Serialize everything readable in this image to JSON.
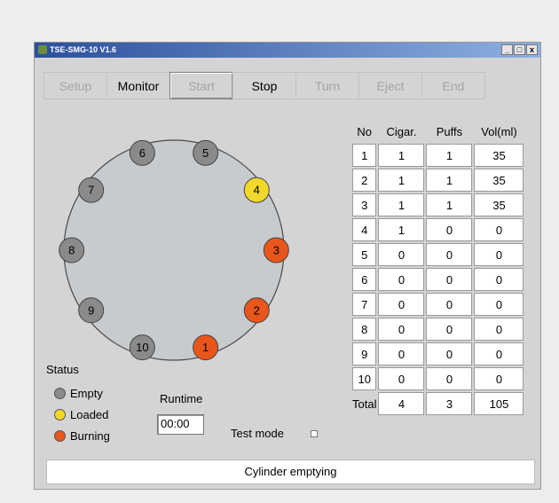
{
  "window": {
    "title": "TSE-SMG-10 V1.6",
    "controls": [
      "_",
      "□",
      "x"
    ]
  },
  "toolbar": [
    {
      "label": "Setup",
      "enabled": false,
      "pressed": false
    },
    {
      "label": "Monitor",
      "enabled": true,
      "pressed": false
    },
    {
      "label": "Start",
      "enabled": false,
      "pressed": true
    },
    {
      "label": "Stop",
      "enabled": true,
      "pressed": false
    },
    {
      "label": "Turn",
      "enabled": false,
      "pressed": false
    },
    {
      "label": "Eject",
      "enabled": false,
      "pressed": false
    },
    {
      "label": "End",
      "enabled": false,
      "pressed": false
    }
  ],
  "wheel": {
    "ports": [
      {
        "number": "1",
        "state": "burning"
      },
      {
        "number": "2",
        "state": "burning"
      },
      {
        "number": "3",
        "state": "burning"
      },
      {
        "number": "4",
        "state": "loaded"
      },
      {
        "number": "5",
        "state": "empty"
      },
      {
        "number": "6",
        "state": "empty"
      },
      {
        "number": "7",
        "state": "empty"
      },
      {
        "number": "8",
        "state": "empty"
      },
      {
        "number": "9",
        "state": "empty"
      },
      {
        "number": "10",
        "state": "empty"
      }
    ],
    "colors": {
      "empty": "#8a8a8a",
      "loaded": "#f2d82a",
      "burning": "#e8561c",
      "disc": "#c8cbce"
    }
  },
  "status": {
    "title": "Status",
    "legend": {
      "empty": "Empty",
      "loaded": "Loaded",
      "burning": "Burning"
    }
  },
  "runtime": {
    "label": "Runtime",
    "value": "00:00"
  },
  "test_mode": {
    "label": "Test mode",
    "checked": false
  },
  "table": {
    "headers": [
      "No",
      "Cigar.",
      "Puffs",
      "Vol(ml)"
    ],
    "rows": [
      [
        "1",
        "1",
        "1",
        "35"
      ],
      [
        "2",
        "1",
        "1",
        "35"
      ],
      [
        "3",
        "1",
        "1",
        "35"
      ],
      [
        "4",
        "1",
        "0",
        "0"
      ],
      [
        "5",
        "0",
        "0",
        "0"
      ],
      [
        "6",
        "0",
        "0",
        "0"
      ],
      [
        "7",
        "0",
        "0",
        "0"
      ],
      [
        "8",
        "0",
        "0",
        "0"
      ],
      [
        "9",
        "0",
        "0",
        "0"
      ],
      [
        "10",
        "0",
        "0",
        "0"
      ]
    ],
    "total": {
      "label": "Total",
      "cigar": "4",
      "puffs": "3",
      "vol": "105"
    }
  },
  "status_message": "Cylinder emptying"
}
